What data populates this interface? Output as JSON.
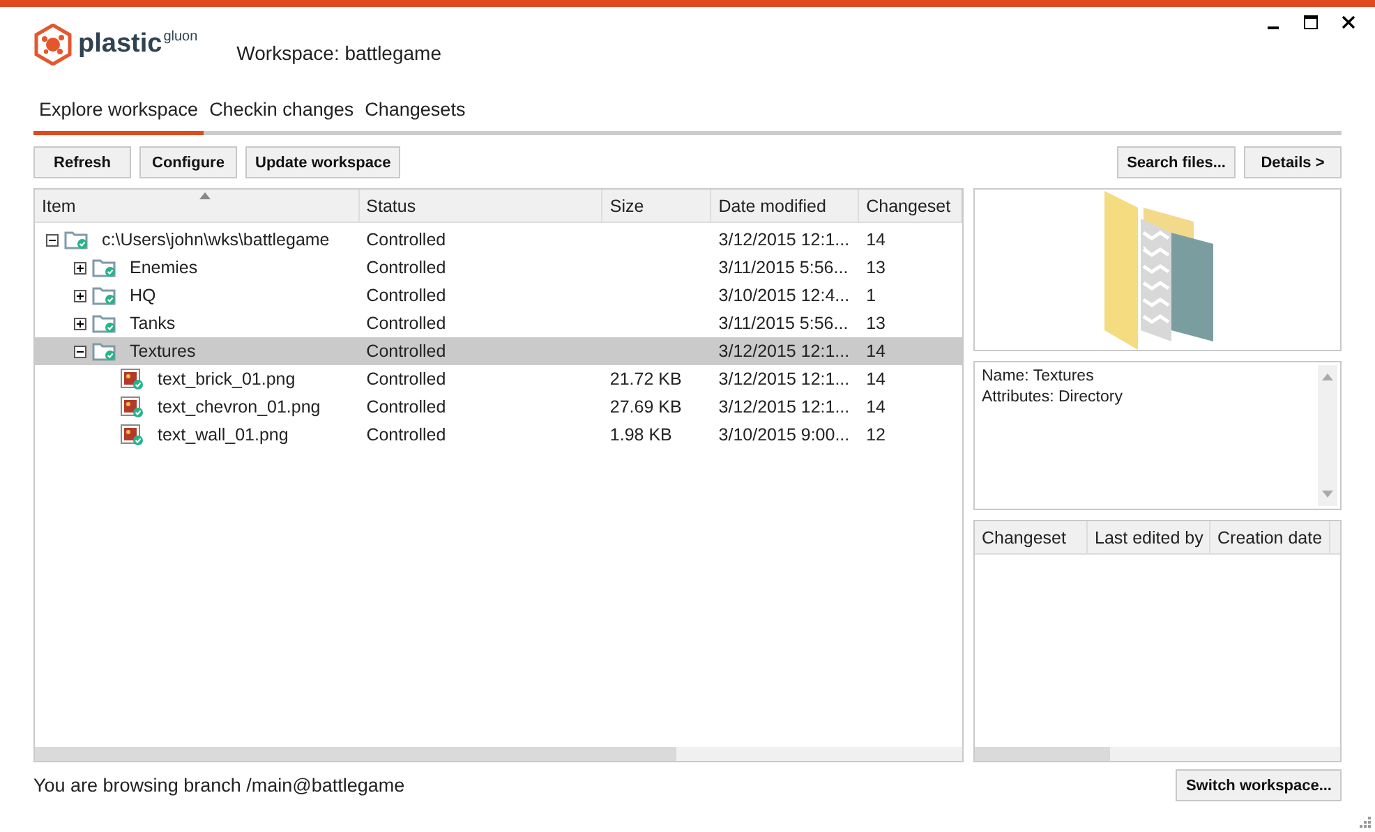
{
  "app": {
    "logo": "plastic",
    "logo_suffix": "gluon",
    "workspace": "Workspace: battlegame"
  },
  "tabs": [
    {
      "label": "Explore workspace",
      "selected": true
    },
    {
      "label": "Checkin changes",
      "selected": false
    },
    {
      "label": "Changesets",
      "selected": false
    }
  ],
  "toolbar": {
    "left": [
      "Refresh",
      "Configure",
      "Update workspace"
    ],
    "right": [
      "Search files...",
      "Details >"
    ]
  },
  "table": {
    "columns": [
      "Item",
      "Status",
      "Size",
      "Date modified",
      "Changeset"
    ],
    "rows": [
      {
        "kind": "folder",
        "name": "c:\\Users\\john\\wks\\battlegame",
        "status": "Controlled",
        "date": "3/12/2015 12:1...",
        "changeset": "14",
        "expanded": true,
        "selected": false,
        "children": [
          {
            "kind": "folder",
            "name": "Enemies",
            "status": "Controlled",
            "date": "3/11/2015 5:56...",
            "changeset": "13",
            "expanded": false,
            "selected": false
          },
          {
            "kind": "folder",
            "name": "HQ",
            "status": "Controlled",
            "date": "3/10/2015 12:4...",
            "changeset": "1",
            "expanded": false,
            "selected": false
          },
          {
            "kind": "folder",
            "name": "Tanks",
            "status": "Controlled",
            "date": "3/11/2015 5:56...",
            "changeset": "13",
            "expanded": false,
            "selected": false
          },
          {
            "kind": "folder",
            "name": "Textures",
            "status": "Controlled",
            "date": "3/12/2015 12:1...",
            "changeset": "14",
            "expanded": true,
            "selected": true,
            "children": [
              {
                "kind": "file",
                "name": "text_brick_01.png",
                "status": "Controlled",
                "size": "21.72 KB",
                "date": "3/12/2015 12:1...",
                "changeset": "14",
                "selected": false
              },
              {
                "kind": "file",
                "name": "text_chevron_01.png",
                "status": "Controlled",
                "size": "27.69 KB",
                "date": "3/12/2015 12:1...",
                "changeset": "14",
                "selected": false
              },
              {
                "kind": "file",
                "name": "text_wall_01.png",
                "status": "Controlled",
                "size": "1.98 KB",
                "date": "3/10/2015 9:00...",
                "changeset": "12",
                "selected": false
              }
            ]
          }
        ]
      }
    ]
  },
  "details": {
    "lines": [
      "Name: Textures",
      "Attributes: Directory"
    ]
  },
  "history": {
    "columns": [
      "Changeset",
      "Last edited by",
      "Creation date"
    ]
  },
  "status_bar": {
    "text": "You are browsing branch /main@battlegame",
    "button": "Switch workspace..."
  }
}
